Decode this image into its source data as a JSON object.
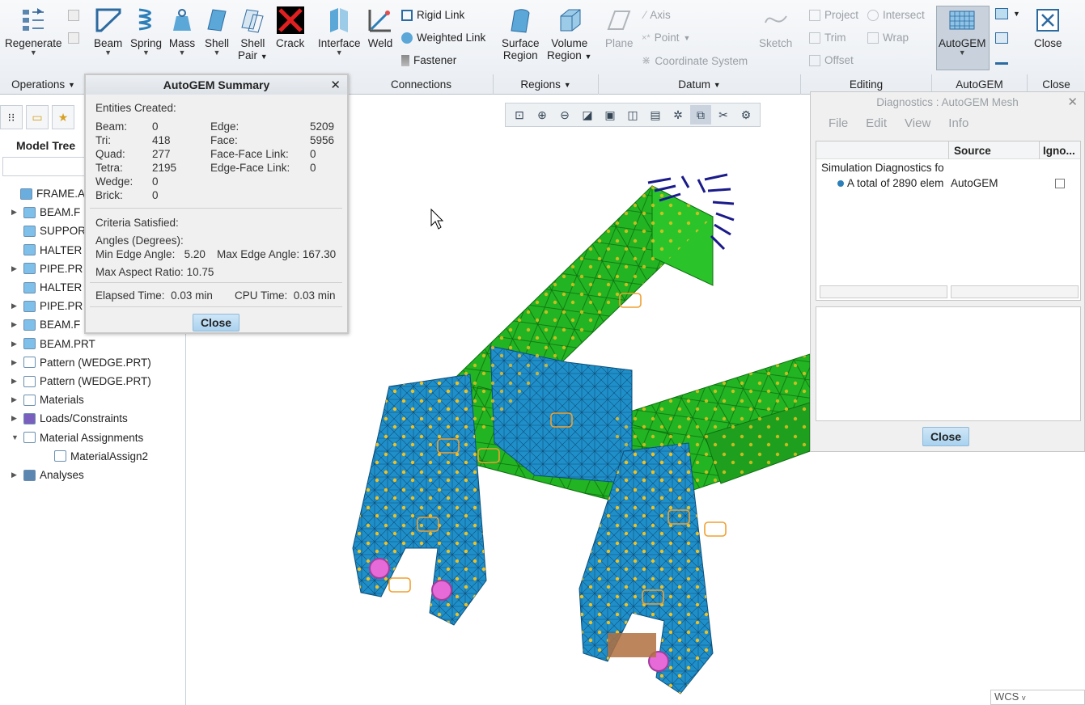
{
  "ribbon": {
    "buttons": {
      "regenerate": "Regenerate",
      "beam": "Beam",
      "spring": "Spring",
      "mass": "Mass",
      "shell": "Shell",
      "shell_pair_1": "Shell",
      "shell_pair_2": "Pair",
      "crack": "Crack",
      "interface": "Interface",
      "weld": "Weld",
      "rigid_link": "Rigid Link",
      "weighted_link": "Weighted Link",
      "fastener": "Fastener",
      "surface_region_1": "Surface",
      "surface_region_2": "Region",
      "volume_region_1": "Volume",
      "volume_region_2": "Region",
      "plane": "Plane",
      "axis": "Axis",
      "point": "Point",
      "coordinate_system": "Coordinate System",
      "sketch": "Sketch",
      "project": "Project",
      "intersect": "Intersect",
      "trim": "Trim",
      "wrap": "Wrap",
      "offset": "Offset",
      "autogem": "AutoGEM",
      "close": "Close"
    },
    "groups": {
      "operations": "Operations",
      "connections": "Connections",
      "regions": "Regions",
      "datum": "Datum",
      "editing": "Editing",
      "autogem": "AutoGEM",
      "close": "Close"
    }
  },
  "model_tree": {
    "title": "Model Tree",
    "items": [
      {
        "label": "FRAME.ASI",
        "icon": "assembly-icon",
        "expand": ""
      },
      {
        "label": "BEAM.F",
        "icon": "part-icon",
        "expand": "▶"
      },
      {
        "label": "SUPPOR",
        "icon": "part-icon",
        "expand": ""
      },
      {
        "label": "HALTER",
        "icon": "part-icon",
        "expand": ""
      },
      {
        "label": "PIPE.PR",
        "icon": "part-icon",
        "expand": "▶"
      },
      {
        "label": "HALTER",
        "icon": "part-icon",
        "expand": ""
      },
      {
        "label": "PIPE.PR",
        "icon": "part-icon",
        "expand": "▶"
      },
      {
        "label": "BEAM.F",
        "icon": "part-icon",
        "expand": "▶"
      },
      {
        "label": "BEAM.PRT",
        "icon": "part-icon",
        "expand": "▶"
      },
      {
        "label": "Pattern (WEDGE.PRT)",
        "icon": "pattern-icon",
        "expand": "▶"
      },
      {
        "label": "Pattern (WEDGE.PRT)",
        "icon": "pattern-icon",
        "expand": "▶"
      },
      {
        "label": "Materials",
        "icon": "materials-icon",
        "expand": "▶"
      },
      {
        "label": "Loads/Constraints",
        "icon": "loads-icon",
        "expand": "▶"
      },
      {
        "label": "Material Assignments",
        "icon": "material-assign-icon",
        "expand": "▼"
      },
      {
        "label": "MaterialAssign2",
        "icon": "material-assign-icon",
        "expand": ""
      },
      {
        "label": "Analyses",
        "icon": "analyses-icon",
        "expand": "▶"
      }
    ]
  },
  "summary": {
    "title": "AutoGEM Summary",
    "entities_created": "Entities Created:",
    "entities_left": [
      {
        "label": "Beam:",
        "value": "0"
      },
      {
        "label": "Tri:",
        "value": "418"
      },
      {
        "label": "Quad:",
        "value": "277"
      },
      {
        "label": "Tetra:",
        "value": "2195"
      },
      {
        "label": "Wedge:",
        "value": "0"
      },
      {
        "label": "Brick:",
        "value": "0"
      }
    ],
    "entities_right": [
      {
        "label": "Edge:",
        "value": "5209"
      },
      {
        "label": "Face:",
        "value": "5956"
      },
      {
        "label": "Face-Face Link:",
        "value": "0"
      },
      {
        "label": "Edge-Face Link:",
        "value": "0"
      }
    ],
    "criteria": "Criteria Satisfied:",
    "angles": "Angles (Degrees):",
    "min_edge_label": "Min Edge Angle:",
    "min_edge_value": "5.20",
    "max_edge_label": "Max Edge Angle:",
    "max_edge_value": "167.30",
    "aspect_label": "Max Aspect Ratio:",
    "aspect_value": "10.75",
    "elapsed_label": "Elapsed Time:",
    "elapsed_value": "0.03 min",
    "cpu_label": "CPU Time:",
    "cpu_value": "0.03 min",
    "close": "Close"
  },
  "diagnostics": {
    "title": "Diagnostics : AutoGEM Mesh",
    "menu": [
      "File",
      "Edit",
      "View",
      "Info"
    ],
    "columns": {
      "source": "Source",
      "ignore": "Igno..."
    },
    "root_row": "Simulation Diagnostics fo",
    "row_message": "A total of 2890 elem",
    "row_source": "AutoGEM",
    "close": "Close"
  },
  "wcs": "WCS",
  "colors": {
    "mesh_green": "#22b422",
    "mesh_blue": "#1f8fc9",
    "node_yellow": "#f0c020",
    "accent": "#a9d2ef"
  }
}
